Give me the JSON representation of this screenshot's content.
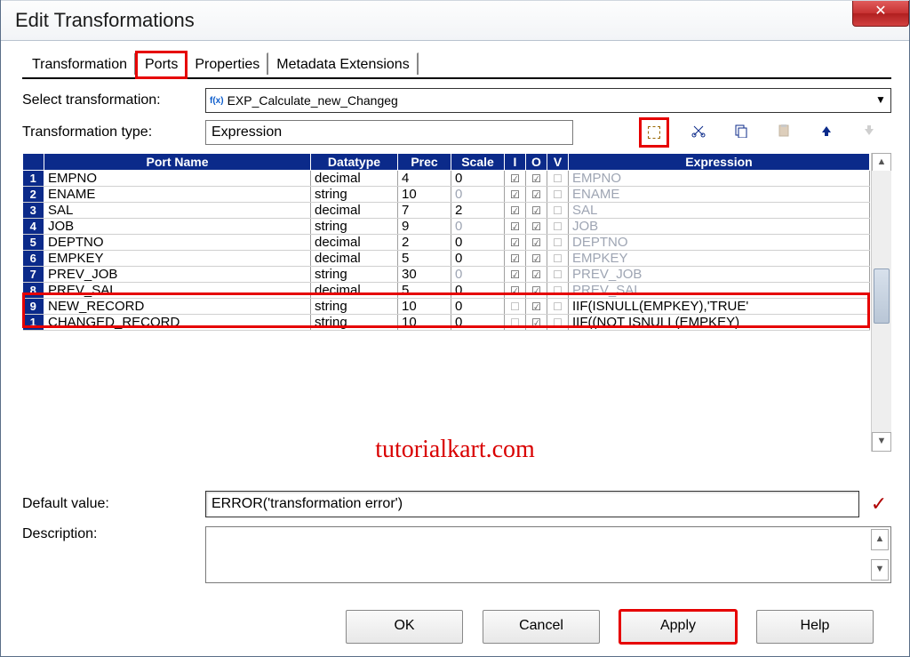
{
  "window_title": "Edit Transformations",
  "tabs": [
    "Transformation",
    "Ports",
    "Properties",
    "Metadata Extensions"
  ],
  "active_tab": 1,
  "select_transformation_label": "Select transformation:",
  "select_transformation_value": "EXP_Calculate_new_Changeg",
  "transformation_type_label": "Transformation type:",
  "transformation_type_value": "Expression",
  "grid": {
    "headers": [
      "Port Name",
      "Datatype",
      "Prec",
      "Scale",
      "I",
      "O",
      "V",
      "Expression"
    ],
    "rows": [
      {
        "n": "1",
        "name": "EMPNO",
        "dtype": "decimal",
        "prec": "4",
        "scale": "0",
        "i": true,
        "o": true,
        "v": false,
        "expr": "EMPNO"
      },
      {
        "n": "2",
        "name": "ENAME",
        "dtype": "string",
        "prec": "10",
        "scale": "0",
        "i": true,
        "o": true,
        "v": false,
        "expr": "ENAME"
      },
      {
        "n": "3",
        "name": "SAL",
        "dtype": "decimal",
        "prec": "7",
        "scale": "2",
        "i": true,
        "o": true,
        "v": false,
        "expr": "SAL"
      },
      {
        "n": "4",
        "name": "JOB",
        "dtype": "string",
        "prec": "9",
        "scale": "0",
        "i": true,
        "o": true,
        "v": false,
        "expr": "JOB"
      },
      {
        "n": "5",
        "name": "DEPTNO",
        "dtype": "decimal",
        "prec": "2",
        "scale": "0",
        "i": true,
        "o": true,
        "v": false,
        "expr": "DEPTNO"
      },
      {
        "n": "6",
        "name": "EMPKEY",
        "dtype": "decimal",
        "prec": "5",
        "scale": "0",
        "i": true,
        "o": true,
        "v": false,
        "expr": "EMPKEY"
      },
      {
        "n": "7",
        "name": "PREV_JOB",
        "dtype": "string",
        "prec": "30",
        "scale": "0",
        "i": true,
        "o": true,
        "v": false,
        "expr": "PREV_JOB"
      },
      {
        "n": "8",
        "name": "PREV_SAL",
        "dtype": "decimal",
        "prec": "5",
        "scale": "0",
        "i": true,
        "o": true,
        "v": false,
        "expr": "PREV_SAL"
      },
      {
        "n": "9",
        "name": "NEW_RECORD",
        "dtype": "string",
        "prec": "10",
        "scale": "0",
        "i": false,
        "o": true,
        "v": false,
        "expr": "IIF(ISNULL(EMPKEY),'TRUE'"
      },
      {
        "n": "1",
        "name": "CHANGED_RECORD",
        "dtype": "string",
        "prec": "10",
        "scale": "0",
        "i": false,
        "o": true,
        "v": false,
        "expr": "IIF((NOT ISNULL(EMPKEY)"
      }
    ]
  },
  "default_value_label": "Default value:",
  "default_value": "ERROR('transformation error')",
  "description_label": "Description:",
  "description_value": "",
  "buttons": {
    "ok": "OK",
    "cancel": "Cancel",
    "apply": "Apply",
    "help": "Help"
  },
  "watermark": "tutorialkart.com"
}
